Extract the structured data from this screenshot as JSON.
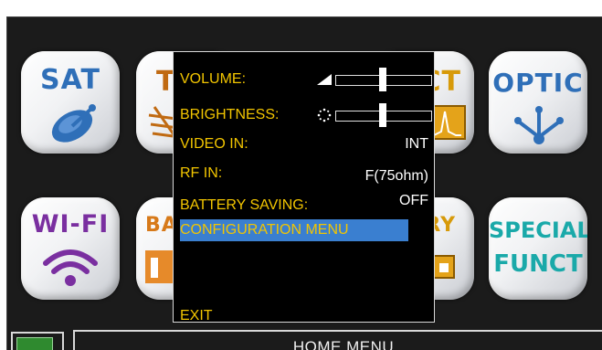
{
  "tiles": {
    "sat": {
      "label": "SAT"
    },
    "wifi": {
      "label": "WI-FI"
    },
    "optic": {
      "label": "OPTIC"
    },
    "special": {
      "line1": "SPECIAL",
      "line2": "FUNCT"
    },
    "tv": {
      "label_fragment": "T"
    },
    "bar": {
      "label_fragment": "BA"
    },
    "ct": {
      "label_fragment": "CT"
    },
    "ry": {
      "label_fragment": "RY"
    }
  },
  "menu": {
    "volume": {
      "label": "VOLUME:",
      "level": 0.5
    },
    "brightness": {
      "label": "BRIGHTNESS:",
      "level": 0.5
    },
    "video_in": {
      "label": "VIDEO IN:",
      "value": "INT"
    },
    "rf_in": {
      "label": "RF IN:",
      "value": "F(75ohm)"
    },
    "battery_saving": {
      "label": "BATTERY SAVING:",
      "value": "OFF"
    },
    "configuration": {
      "label": "CONFIGURATION MENU"
    },
    "exit": {
      "label": "EXIT"
    }
  },
  "status": {
    "home_title": "HOME MENU"
  },
  "colors": {
    "menu_text": "#f2c500",
    "highlight": "#3a7fd0",
    "sat_blue": "#2f6fb8",
    "wifi_purple": "#7a2fa0",
    "special_teal": "#1aa9a9",
    "battery_green": "#2f8a2f"
  }
}
